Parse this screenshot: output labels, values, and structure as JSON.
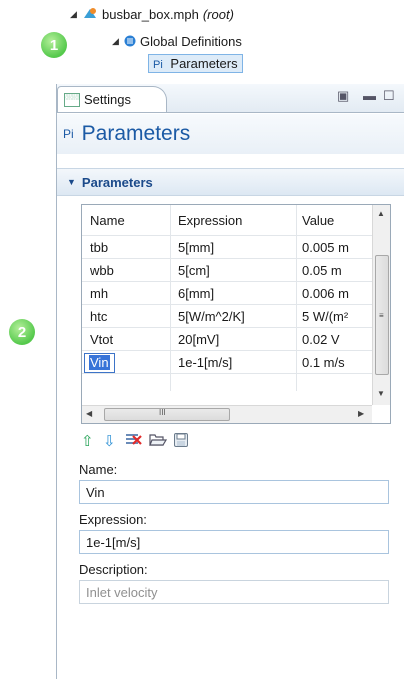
{
  "tree": {
    "root_name": "busbar_box.mph",
    "root_suffix": "(root)",
    "global_definitions": "Global Definitions",
    "parameters_node": "Parameters"
  },
  "badges": [
    "1",
    "2"
  ],
  "window": {
    "tab_label": "Settings",
    "title_symbol": "Pi",
    "title": "Parameters",
    "section_title": "Parameters"
  },
  "table": {
    "columns": [
      "Name",
      "Expression",
      "Value"
    ],
    "rows": [
      {
        "name": "tbb",
        "expression": "5[mm]",
        "value": "0.005 m"
      },
      {
        "name": "wbb",
        "expression": "5[cm]",
        "value": "0.05 m"
      },
      {
        "name": "mh",
        "expression": "6[mm]",
        "value": "0.006 m"
      },
      {
        "name": "htc",
        "expression": "5[W/m^2/K]",
        "value": "5 W/(m²"
      },
      {
        "name": "Vtot",
        "expression": "20[mV]",
        "value": "0.02 V"
      },
      {
        "name": "Vin",
        "expression": "1e-1[m/s]",
        "value": "0.1 m/s"
      }
    ],
    "hscroll_mid": "III"
  },
  "toolbar": {
    "up_icon": "arrow-up-icon",
    "down_icon": "arrow-down-icon",
    "delete_icon": "delete-icon",
    "open_icon": "folder-open-icon",
    "save_icon": "save-icon"
  },
  "form": {
    "name_label": "Name:",
    "name_value": "Vin",
    "expression_label": "Expression:",
    "expression_value": "1e-1[m/s]",
    "description_label": "Description:",
    "description_value": "Inlet velocity"
  },
  "colors": {
    "accent_blue": "#1b5aa5",
    "badge_green": "#55c94c",
    "selection": "#3874d8"
  }
}
